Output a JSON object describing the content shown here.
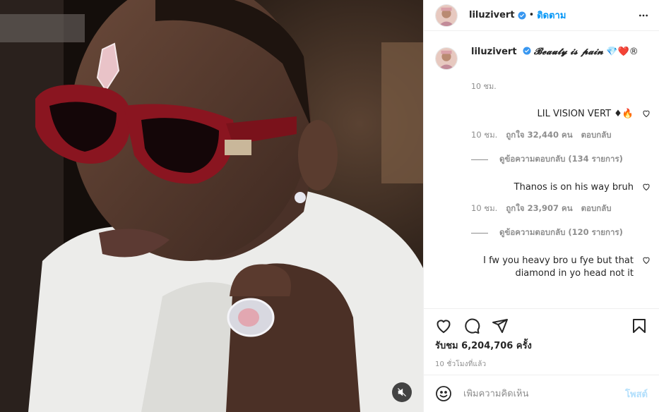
{
  "post": {
    "username": "liluzivert",
    "follow_label": "ติดตาม",
    "dot": "•",
    "more_icon": "more-options-icon"
  },
  "caption": {
    "username": "liluzivert",
    "text": "𝓑𝓮𝓪𝓾𝓽𝔂 𝓲𝓼 𝓹𝓪𝓲𝓷",
    "emojis": "💎❤️®",
    "time": "10 ชม."
  },
  "comments": [
    {
      "text": "LIL VISION VERT ♦🔥",
      "time": "10 ชม.",
      "likes": "ถูกใจ 32,440 คน",
      "reply": "ตอบกลับ",
      "view_replies": "ดูข้อความตอบกลับ (134 รายการ)"
    },
    {
      "text": "Thanos is on his way bruh",
      "time": "10 ชม.",
      "likes": "ถูกใจ 23,907 คน",
      "reply": "ตอบกลับ",
      "view_replies": "ดูข้อความตอบกลับ (120 รายการ)"
    },
    {
      "text": "I fw you heavy bro u fye but that diamond in yo head not it"
    }
  ],
  "stats": {
    "views": "รับชม 6,204,706 ครั้ง",
    "posted": "10 ชั่วโมงที่แล้ว"
  },
  "add_comment": {
    "placeholder": "เพิ่มความคิดเห็น",
    "post_label": "โพสต์"
  },
  "colors": {
    "accent": "#0095f6",
    "post_disabled": "#b2dffc",
    "secondary_text": "#8e8e8e"
  },
  "icons": [
    "heart-icon",
    "comment-icon",
    "share-icon",
    "bookmark-icon",
    "emoji-icon",
    "mute-icon",
    "verified-icon"
  ]
}
